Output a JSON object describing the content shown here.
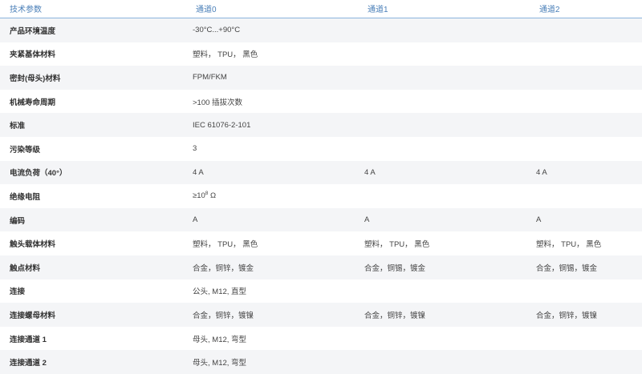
{
  "header": {
    "param_label": "技术参数",
    "channels": [
      "通道0",
      "通道1",
      "通道2"
    ]
  },
  "rows": [
    {
      "param": "产品环境温度",
      "ch0": "-30°C...+90°C",
      "ch1": "",
      "ch2": ""
    },
    {
      "param": "夹紧基体材料",
      "ch0": "塑料， TPU， 黑色",
      "ch1": "",
      "ch2": ""
    },
    {
      "param": "密封(母头)材料",
      "ch0": "FPM/FKM",
      "ch1": "",
      "ch2": ""
    },
    {
      "param": "机械寿命周期",
      "ch0": ">100 插拔次数",
      "ch1": "",
      "ch2": ""
    },
    {
      "param": "标准",
      "ch0": "IEC 61076-2-101",
      "ch1": "",
      "ch2": ""
    },
    {
      "param": "污染等级",
      "ch0": "3",
      "ch1": "",
      "ch2": ""
    },
    {
      "param": "电流负荷（40°）",
      "ch0": "4 A",
      "ch1": "4 A",
      "ch2": "4 A"
    },
    {
      "param": "绝缘电阻",
      "ch0_prefix": "≥10",
      "ch0_sup": "8",
      "ch0_suffix": " Ω",
      "ch1": "",
      "ch2": ""
    },
    {
      "param": "编码",
      "ch0": "A",
      "ch1": "A",
      "ch2": "A"
    },
    {
      "param": "触头载体材料",
      "ch0": "塑料， TPU， 黑色",
      "ch1": "塑料， TPU， 黑色",
      "ch2": "塑料， TPU， 黑色"
    },
    {
      "param": "触点材料",
      "ch0": "合金，铜锌，镀金",
      "ch1": "合金，铜锡，镀金",
      "ch2": "合金，铜锡，镀金"
    },
    {
      "param": "连接",
      "ch0": "公头, M12, 直型",
      "ch1": "",
      "ch2": ""
    },
    {
      "param": "连接螺母材料",
      "ch0": "合金，铜锌，镀镍",
      "ch1": "合金，铜锌，镀镍",
      "ch2": "合金，铜锌，镀镍"
    },
    {
      "param": "连接通道 1",
      "ch0": "母头, M12, 弯型",
      "ch1": "",
      "ch2": ""
    },
    {
      "param": "连接通道 2",
      "ch0": "母头, M12, 弯型",
      "ch1": "",
      "ch2": ""
    }
  ]
}
